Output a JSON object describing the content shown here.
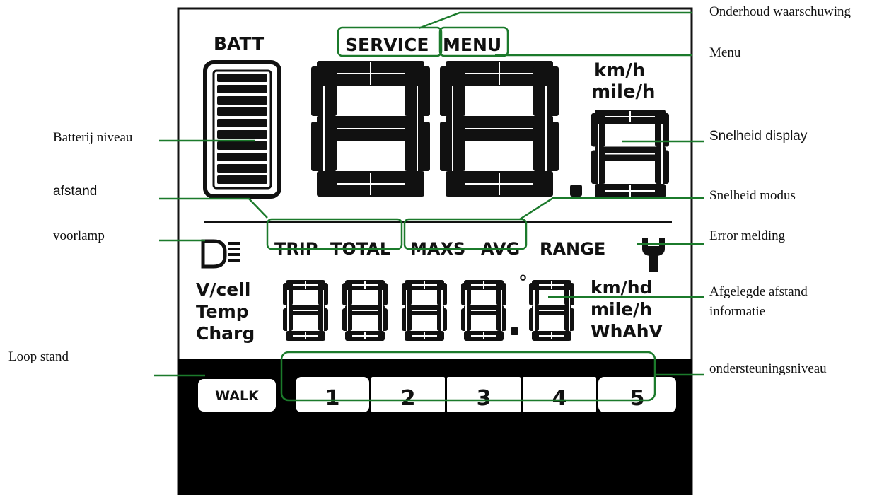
{
  "display": {
    "batt_label": "BATT",
    "service_label": "SERVICE",
    "menu_label": "MENU",
    "speed_unit_kmh": "km/h",
    "speed_unit_mileh": "mile/h",
    "trip_label": "TRIP",
    "total_label": "TOTAL",
    "maxs_label": "MAXS",
    "avg_label": "AVG",
    "range_label": "RANGE",
    "vcell_label": "V/cell",
    "temp_label": "Temp",
    "charg_label": "Charg",
    "degree_symbol": "°",
    "unit_kmhd": "km/hd",
    "unit_mileh": "mile/h",
    "unit_whahv": "WhAhV",
    "walk_label": "WALK",
    "assist_levels": [
      "1",
      "2",
      "3",
      "4",
      "5"
    ]
  },
  "callouts": {
    "onderhoud": "Onderhoud waarschuwing",
    "menu": "Menu",
    "batterij": "Batterij niveau",
    "snelheid_display": "Snelheid display",
    "afstand": "afstand",
    "snelheid_modus": "Snelheid modus",
    "voorlamp": "voorlamp",
    "error": "Error melding",
    "afgelegde_line1": "Afgelegde afstand",
    "afgelegde_line2": "informatie",
    "loop_stand": "Loop stand",
    "ondersteuning": "ondersteuningsniveau"
  },
  "colors": {
    "callout_line": "#1b7a2b",
    "lcd_segment": "#111111",
    "lcd_background": "#ffffff",
    "bottom_bar": "#000000"
  }
}
